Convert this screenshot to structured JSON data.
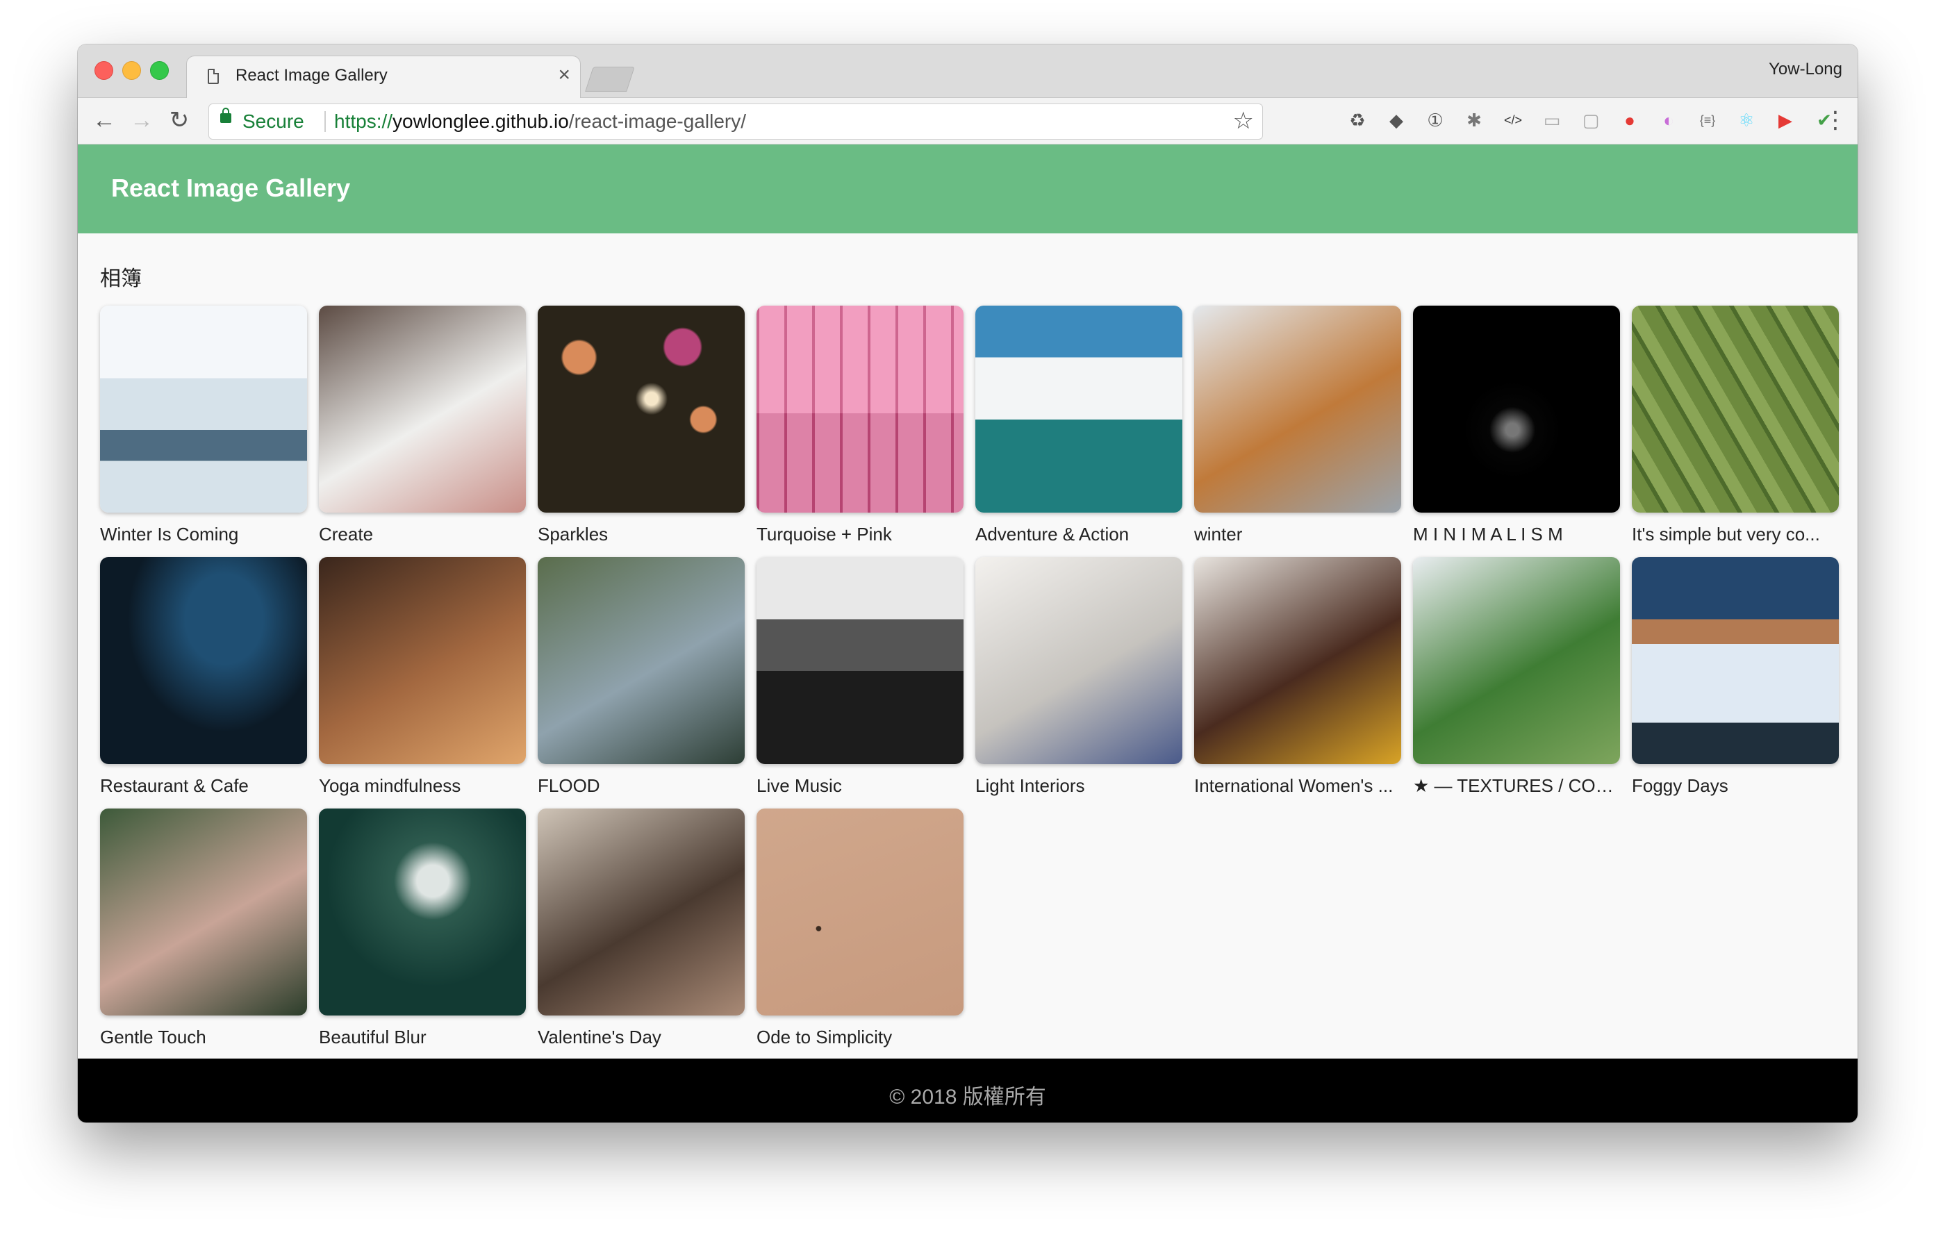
{
  "browser": {
    "tab_title": "React Image Gallery",
    "tab_close": "×",
    "profile_name": "Yow-Long",
    "secure_label": "Secure",
    "url_scheme": "https://",
    "url_host": "yowlonglee.github.io",
    "url_path": "/react-image-gallery/",
    "back_glyph": "←",
    "forward_glyph": "→",
    "reload_glyph": "↻",
    "star_glyph": "☆",
    "menu_glyph": "⋮",
    "extensions": [
      {
        "icon": "recycle-icon",
        "glyph": "♻",
        "color": "#555555"
      },
      {
        "icon": "pocket-icon",
        "glyph": "◆",
        "color": "#555555"
      },
      {
        "icon": "onepassword-icon",
        "glyph": "①",
        "color": "#555555"
      },
      {
        "icon": "bug-icon",
        "glyph": "✱",
        "color": "#777777"
      },
      {
        "icon": "code-icon",
        "glyph": "</>",
        "color": "#333333"
      },
      {
        "icon": "keyboard-icon",
        "glyph": "▭",
        "color": "#aaaaaa"
      },
      {
        "icon": "window-icon",
        "glyph": "▢",
        "color": "#aaaaaa"
      },
      {
        "icon": "lastpass-icon",
        "glyph": "●",
        "color": "#e53935"
      },
      {
        "icon": "gradient-icon",
        "glyph": "◐",
        "color": "#c86dd7"
      },
      {
        "icon": "json-icon",
        "glyph": "{≡}",
        "color": "#777777"
      },
      {
        "icon": "react-devtools-icon",
        "glyph": "⚛",
        "color": "#61dafb"
      },
      {
        "icon": "youtube-icon",
        "glyph": "▶",
        "color": "#e53935"
      },
      {
        "icon": "shield-icon",
        "glyph": "✔",
        "color": "#43a047"
      },
      {
        "icon": "page-icon",
        "glyph": "▯",
        "color": "#9e9e9e"
      }
    ]
  },
  "app": {
    "title": "React Image Gallery",
    "album_heading": "相簿",
    "footer": "© 2018 版權所有",
    "colors": {
      "header": "#6abc84",
      "footer": "#000000",
      "page_background": "#f9f9f9"
    }
  },
  "gallery": [
    {
      "caption": "Winter Is Coming",
      "theme": "snowy-sea-ice",
      "colors": [
        "#f4f7fa",
        "#d6e2ea",
        "#4e6c82"
      ]
    },
    {
      "caption": "Create",
      "theme": "drawing-hand",
      "colors": [
        "#5c4b43",
        "#efefed",
        "#c98f88"
      ]
    },
    {
      "caption": "Sparkles",
      "theme": "sparkler-bokeh",
      "colors": [
        "#2a2419",
        "#d98b5a",
        "#b8447a"
      ]
    },
    {
      "caption": "Turquoise + Pink",
      "theme": "pink-panels",
      "colors": [
        "#f08db5",
        "#dc5b8f",
        "#c64a7b"
      ]
    },
    {
      "caption": "Adventure & Action",
      "theme": "surf-wave",
      "colors": [
        "#3d8bbd",
        "#f3f5f6",
        "#1f7e7e"
      ]
    },
    {
      "caption": "winter",
      "theme": "snowy-logs",
      "colors": [
        "#e4e8ec",
        "#c07a3a",
        "#9aa3ab"
      ]
    },
    {
      "caption": "M I N I M A L I S M",
      "theme": "black-minimal",
      "colors": [
        "#000000",
        "#050505",
        "#777777"
      ]
    },
    {
      "caption": "It's simple but very co...",
      "theme": "green-field",
      "colors": [
        "#6d8a3e",
        "#8aa556",
        "#4d6b2b"
      ]
    },
    {
      "caption": "Restaurant & Cafe",
      "theme": "neon-sign",
      "colors": [
        "#0c1a26",
        "#1f4f73",
        "#4ec3ff"
      ]
    },
    {
      "caption": "Yoga mindfulness",
      "theme": "warm-window",
      "colors": [
        "#3a261c",
        "#a36840",
        "#e0a56b"
      ]
    },
    {
      "caption": "FLOOD",
      "theme": "waterfall",
      "colors": [
        "#5a6d4c",
        "#8fa2ad",
        "#2d3e35"
      ]
    },
    {
      "caption": "Live Music",
      "theme": "bw-concert",
      "colors": [
        "#e8e8e8",
        "#555555",
        "#1c1c1c"
      ]
    },
    {
      "caption": "Light Interiors",
      "theme": "white-room",
      "colors": [
        "#f3f1ee",
        "#c6c3be",
        "#4a5a8a"
      ]
    },
    {
      "caption": "International Women's ...",
      "theme": "portrait-headwrap",
      "colors": [
        "#e8e4df",
        "#4a2b1f",
        "#d8a326"
      ]
    },
    {
      "caption": "★ — TEXTURES / COL...",
      "theme": "snow-moss",
      "colors": [
        "#e9edf0",
        "#3f7d34",
        "#7ea55d"
      ]
    },
    {
      "caption": "Foggy Days",
      "theme": "foggy-mountain",
      "colors": [
        "#24476e",
        "#dfe9f3",
        "#b37a52"
      ]
    },
    {
      "caption": "Gentle Touch",
      "theme": "butterfly-hands",
      "colors": [
        "#3d5a3a",
        "#c8a497",
        "#2b3d2a"
      ]
    },
    {
      "caption": "Beautiful Blur",
      "theme": "dandelion",
      "colors": [
        "#123a33",
        "#2d5a4e",
        "#dfe5e3"
      ]
    },
    {
      "caption": "Valentine's Day",
      "theme": "couple-kiss",
      "colors": [
        "#cfc4b7",
        "#4a3a30",
        "#a98a76"
      ]
    },
    {
      "caption": "Ode to Simplicity",
      "theme": "sand-minimal",
      "colors": [
        "#d0a78c",
        "#c79a7e",
        "#3a2a20"
      ]
    }
  ]
}
